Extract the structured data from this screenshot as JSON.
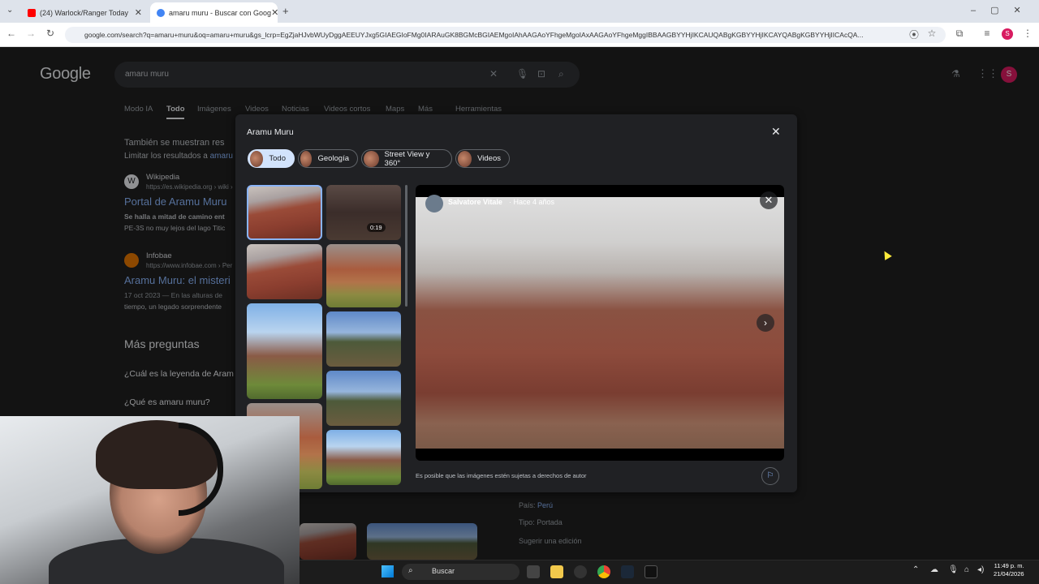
{
  "browser": {
    "tabs": [
      {
        "title": "(24) Warlock/Ranger Today",
        "favicon_color": "#ff0000"
      },
      {
        "title": "amaru muru - Buscar con Goog",
        "favicon_color": "#4285f4"
      }
    ],
    "url": "google.com/search?q=amaru+muru&oq=amaru+muru&gs_lcrp=EgZjaHJvbWUyDggAEEUYJxg5GIAEGIoFMg0IARAuGK8BGMcBGIAEMgoIAhAAGAoYFhgeMgoIAxAAGAoYFhgeMggIBBAAGBYYHjIKCAUQABgKGBYYHjIKCAYQABgKGBYYHjIICAcQA...",
    "profile_letter": "S"
  },
  "google": {
    "logo": "Google",
    "query": "amaru muru",
    "nav_tabs": [
      "Modo IA",
      "Todo",
      "Imágenes",
      "Videos",
      "Noticias",
      "Videos cortos",
      "Maps",
      "Más",
      "Herramientas"
    ],
    "also_showing": "También se muestran res",
    "limit_results": "Limitar los resultados a",
    "limit_link": "amaru",
    "results": [
      {
        "source": "Wikipedia",
        "url": "https://es.wikipedia.org › wiki ›",
        "title": "Portal de Aramu Muru",
        "snippet1": "Se halla a mitad de camino ent",
        "snippet2": "PE-3S no muy lejos del lago Titic"
      },
      {
        "source": "Infobae",
        "url": "https://www.infobae.com › Per",
        "title": "Aramu Muru: el misteri",
        "snippet1": "17 oct 2023 — En las alturas de",
        "snippet2": "tiempo, un legado sorprendente"
      }
    ],
    "more_questions": "Más preguntas",
    "questions": [
      "¿Cuál es la leyenda de Aram",
      "¿Qué es amaru muru?"
    ],
    "info_pais_label": "País:",
    "info_pais_value": "Perú",
    "info_tipo_label": "Tipo:",
    "info_tipo_value": "Portada",
    "suggest_edit": "Sugerir una edición"
  },
  "panel": {
    "title": "Aramu Muru",
    "chips": [
      "Todo",
      "Geología",
      "Street View y 360°",
      "Videos"
    ],
    "video_duration": "0:19",
    "author": "Salvatore Vitale",
    "age": "Hace 4 años",
    "copyright": "Es posible que las imágenes estén sujetas a derechos de autor"
  },
  "taskbar": {
    "search_placeholder": "Buscar",
    "time": "11:49 p. m.",
    "date": "21/04/2026"
  }
}
